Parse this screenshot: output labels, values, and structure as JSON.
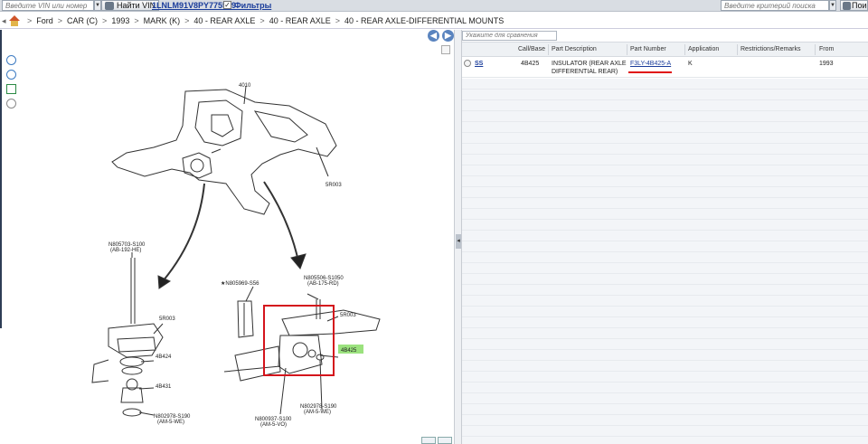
{
  "toolbar": {
    "vin_placeholder": "Введите VIN или номер",
    "find_vin_label": "Найти VIN",
    "vin_number": "1LNLM91V8PY775539",
    "filters_label": "Фильтры",
    "criteria_placeholder": "Введите критерий поиска",
    "search_label": "Поиск"
  },
  "breadcrumb": {
    "items": [
      "Ford",
      "CAR (C)",
      "1993",
      "MARK (K)",
      "40 - REAR AXLE",
      "40 - REAR AXLE",
      "40 - REAR AXLE-DIFFERENTIAL MOUNTS"
    ]
  },
  "diagram": {
    "labels": {
      "a": "4010",
      "b": "5R003",
      "c": "N805703-S100",
      "d": "(AB-192-HE)",
      "e": "5R003",
      "f": "4B424",
      "g": "4B431",
      "h": "N802978-S190",
      "i": "(AM-5-WE)",
      "j": "★N805969-S56",
      "k": "N805506-S1050",
      "l": "(AB-175-RD)",
      "m": "5R003",
      "n": "4B425",
      "o": "N800937-S100",
      "p": "(AM-5-VO)",
      "q": "N802978-S190",
      "r": "(AM-5-WE)"
    },
    "highlight_color": "#d4141c",
    "callout_color": "#9be27e"
  },
  "table": {
    "compare_placeholder": "Укажите для сравнения",
    "columns": [
      "Call/Base",
      "Part Description",
      "Part Number",
      "Application",
      "Restrictions/Remarks",
      "From"
    ],
    "rows": [
      {
        "link": "SS",
        "callbase": "4B425",
        "desc_line1": "INSULATOR (REAR AXLE",
        "desc_line2": "DIFFERENTIAL REAR)",
        "part_number": "F3LY-4B425-A",
        "application": "K",
        "remarks": "",
        "from": "1993"
      }
    ]
  },
  "colors": {
    "link": "#1a3c9a",
    "underline_marker": "#e01010",
    "nav_button": "#5a84bf"
  }
}
